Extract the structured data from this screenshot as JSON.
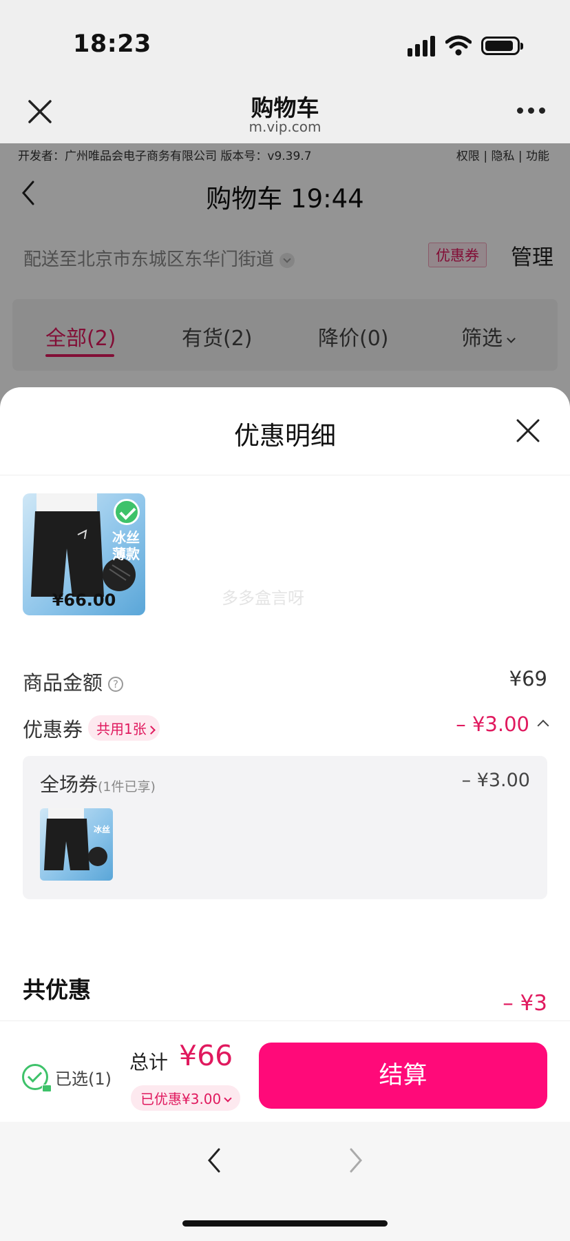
{
  "status_bar": {
    "time": "18:23"
  },
  "browser": {
    "title": "购物车",
    "url": "m.vip.com"
  },
  "page": {
    "developer_info": "开发者：广州唯品会电子商务有限公司 版本号：v9.39.7",
    "links": "权限 | 隐私 | 功能",
    "title": "购物车 19:44",
    "delivery": "配送至北京市东城区东华门街道",
    "coupon_tag": "优惠券",
    "manage": "管理",
    "filters": {
      "all": "全部(2)",
      "in_stock": "有货(2)",
      "price_drop": "降价(0)",
      "filter": "筛选"
    }
  },
  "sheet": {
    "title": "优惠明细",
    "product": {
      "badge1": "冰丝",
      "badge2": "薄款",
      "price": "¥66.00"
    },
    "watermark": "多多盒言呀",
    "goods_amount_label": "商品金额",
    "goods_amount_help": "?",
    "goods_amount_value": "¥69",
    "coupon_label": "优惠券",
    "coupon_pill": "共用1张",
    "coupon_value": "– ¥3.00",
    "coupon_box": {
      "name": "全场券",
      "sub": "(1件已享)",
      "amount": "– ¥3.00",
      "thumb_label": "冰丝"
    },
    "total_label": "共优惠",
    "total_value": "– ¥3"
  },
  "bottom_bar": {
    "selected": "已选(1)",
    "sum_label": "总计",
    "sum_value": "¥66",
    "discount": "已优惠¥3.00",
    "checkout": "结算"
  },
  "colors": {
    "accent": "#e0195e",
    "checkout": "#ff0a79",
    "success": "#3ec26a"
  }
}
